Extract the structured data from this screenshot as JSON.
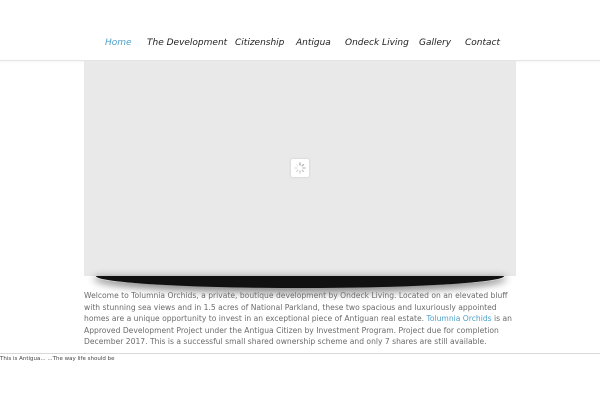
{
  "nav": {
    "items": [
      {
        "label": "Home",
        "active": true
      },
      {
        "label": "The Development",
        "active": false
      },
      {
        "label": "Citizenship",
        "active": false
      },
      {
        "label": "Antigua",
        "active": false
      },
      {
        "label": "Ondeck Living",
        "active": false
      },
      {
        "label": "Gallery",
        "active": false
      },
      {
        "label": "Contact",
        "active": false
      }
    ]
  },
  "slider": {
    "loader_icon": "loading-spinner-icon"
  },
  "intro": {
    "text_before_link": "Welcome to Tolumnia Orchids, a private, boutique development by Ondeck Living. Located on an elevated bluff with stunning sea views and in 1.5 acres of National Parkland, these two spacious and luxuriously appointed homes are a unique opportunity to invest in an exceptional piece of Antiguan real estate. ",
    "link_text": "Tolumnia Orchids",
    "text_after_link": " is an Approved Development Project under the Antigua Citizen by Investment Program. Project due for completion December 2017. This is a successful small shared ownership scheme and only 7 shares are still available."
  },
  "footer": {
    "tagline": "This is Antigua... ...The way life should be"
  },
  "colors": {
    "accent": "#4da0c9",
    "text": "#6b6b6b",
    "slider_bg": "#e9e9e9"
  }
}
